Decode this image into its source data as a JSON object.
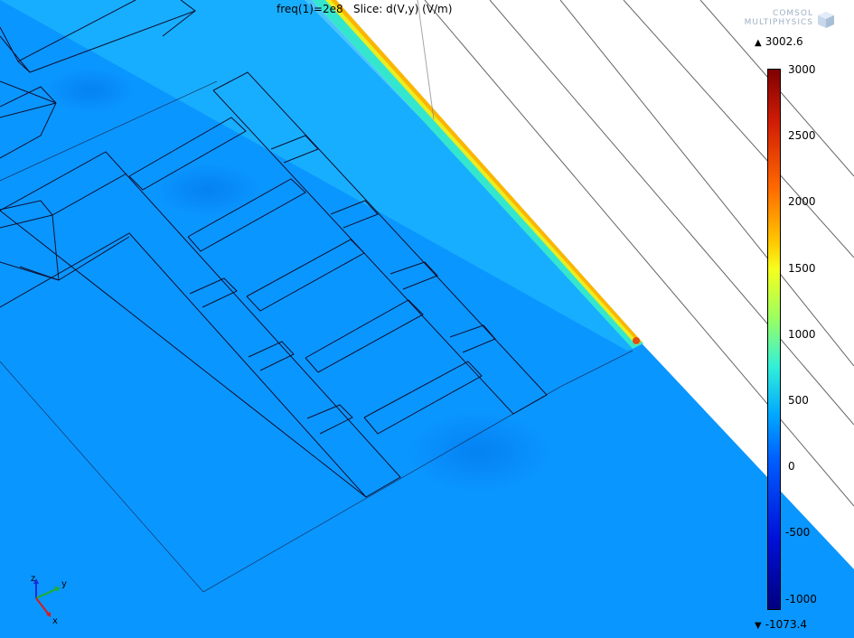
{
  "plot": {
    "title": "freq(1)=2e8   Slice: d(V,y) (V/m)"
  },
  "logo": {
    "line1": "COMSOL",
    "line2": "MULTIPHYSICS"
  },
  "colorbar": {
    "max_label": "3002.6",
    "min_label": "-1073.4",
    "ticks": [
      "3000",
      "2500",
      "2000",
      "1500",
      "1000",
      "500",
      "0",
      "-500",
      "-1000"
    ],
    "colors": [
      "#7f0000",
      "#ff6a00",
      "#f6ff1e",
      "#32f0d8",
      "#00a8ff",
      "#0060ff",
      "#00007f"
    ]
  },
  "axes": {
    "z": "z",
    "y": "y",
    "x": "x"
  },
  "colors": {
    "field": "#0a96ff",
    "background": "#ffffff"
  }
}
